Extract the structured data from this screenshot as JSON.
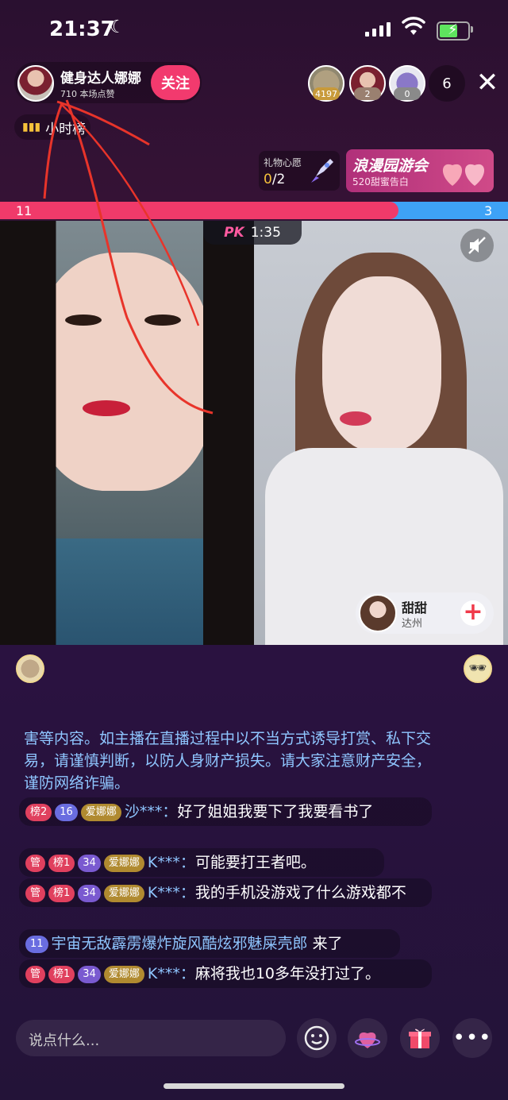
{
  "status_bar": {
    "time": "21:37"
  },
  "host": {
    "name": "健身达人娜娜",
    "likes": "710 本场点赞",
    "follow_label": "关注"
  },
  "viewers": {
    "badges": [
      "4197",
      "2",
      "0"
    ],
    "count": "6"
  },
  "rank_label": "小时榜",
  "gift_wish": {
    "title": "礼物心愿",
    "current": "0",
    "total": "/2"
  },
  "promo": {
    "title": "浪漫园游会",
    "subtitle": "520甜蜜告白"
  },
  "pk": {
    "left_score": "11",
    "right_score": "3",
    "logo": "PK",
    "timer": "1:35",
    "red_fraction": 0.784
  },
  "opponent": {
    "name": "甜甜",
    "city": "达州"
  },
  "chat": {
    "notice": "害等内容。如主播在直播过程中以不当方式诱导打赏、私下交易，请谨慎判断，以防人身财产损失。请大家注意财产安全，谨防网络诈骗。",
    "messages": [
      {
        "tags": [
          "榜2",
          "16",
          "爱娜娜"
        ],
        "user": "沙***：",
        "text": "好了姐姐我要下了我要看书了"
      },
      {
        "tags": [
          "管",
          "榜1",
          "34",
          "爱娜娜"
        ],
        "user": "K***：",
        "text": "可能要打王者吧。"
      },
      {
        "tags": [
          "管",
          "榜1",
          "34",
          "爱娜娜"
        ],
        "user": "K***：",
        "text": "我的手机没游戏了什么游戏都不"
      },
      {
        "tags": [
          "11"
        ],
        "user": "宇宙无敌霹雳爆炸旋风酷炫邪魅屎壳郎",
        "text": "来了"
      },
      {
        "tags": [
          "管",
          "榜1",
          "34",
          "爱娜娜"
        ],
        "user": "K***：",
        "text": "麻将我也10多年没打过了。"
      }
    ]
  },
  "input": {
    "placeholder": "说点什么..."
  },
  "colors": {
    "accent": "#f23a6e",
    "pk_red": "#f03a6a",
    "pk_blue": "#3ea2f6",
    "username": "#8fc6ff"
  }
}
